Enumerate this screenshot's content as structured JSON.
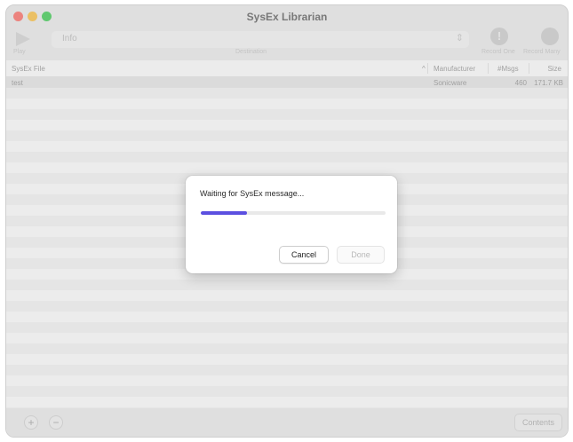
{
  "window": {
    "title": "SysEx Librarian"
  },
  "toolbar": {
    "destination_value": "Info",
    "play_label": "Play",
    "destination_label": "Destination",
    "record_one_label": "Record One",
    "record_many_label": "Record Many",
    "record_one_glyph": "!",
    "chevron_glyph": "⇕"
  },
  "table": {
    "columns": {
      "file": "SysEx File",
      "sort_indicator": "^",
      "manufacturer": "Manufacturer",
      "msgs": "#Msgs",
      "size": "Size"
    },
    "rows": [
      {
        "file": "test",
        "manufacturer": "Sonicware",
        "msgs": "460",
        "size": "171.7 KB"
      }
    ]
  },
  "bottom": {
    "add": "+",
    "remove": "−",
    "contents": "Contents"
  },
  "dialog": {
    "message": "Waiting for SysEx message...",
    "progress": 0.25,
    "cancel": "Cancel",
    "done": "Done"
  },
  "colors": {
    "accent": "#5b4fe0",
    "close": "#ff5f57",
    "minimize": "#febc2e",
    "zoom": "#28c840"
  },
  "icons": [
    "play-icon",
    "exclamation-icon",
    "record-many-icon",
    "chevron-updown-icon"
  ]
}
